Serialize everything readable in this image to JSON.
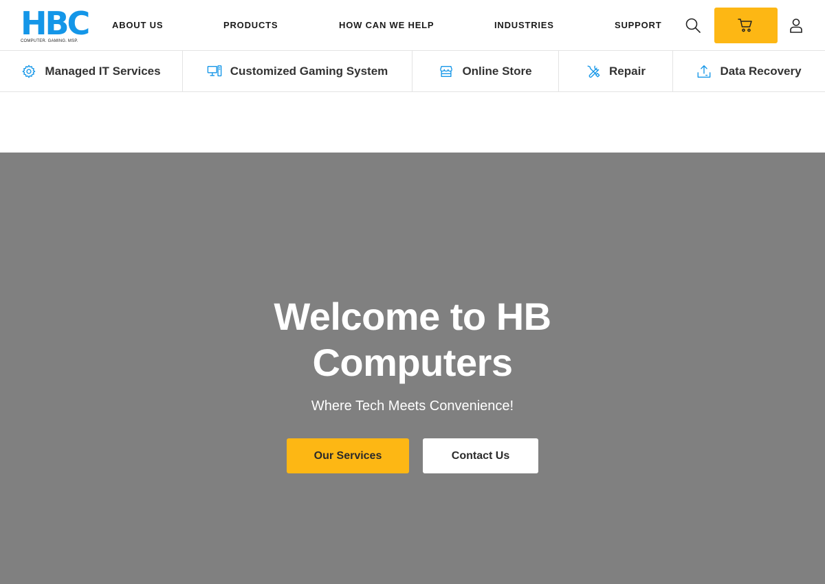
{
  "brand": {
    "logo_text": "HBC",
    "tagline": "COMPUTER. GAMING. MSP."
  },
  "nav": {
    "items": [
      "ABOUT US",
      "PRODUCTS",
      "HOW CAN WE HELP",
      "INDUSTRIES",
      "SUPPORT"
    ]
  },
  "header_icons": [
    "search-icon",
    "cart-icon",
    "user-icon"
  ],
  "services": [
    {
      "label": "Managed IT Services",
      "icon": "gear-icon"
    },
    {
      "label": "Customized Gaming System",
      "icon": "desktop-pc-icon"
    },
    {
      "label": "Online Store",
      "icon": "storefront-icon"
    },
    {
      "label": "Repair",
      "icon": "tools-icon"
    },
    {
      "label": "Data Recovery",
      "icon": "upload-icon"
    }
  ],
  "hero": {
    "title": "Welcome to HB Computers",
    "subtitle": "Where Tech Meets Convenience!",
    "primary_button": "Our Services",
    "secondary_button": "Contact Us"
  },
  "colors": {
    "brand_blue": "#1496e8",
    "accent_yellow": "#fdb714",
    "hero_background": "#808080"
  }
}
